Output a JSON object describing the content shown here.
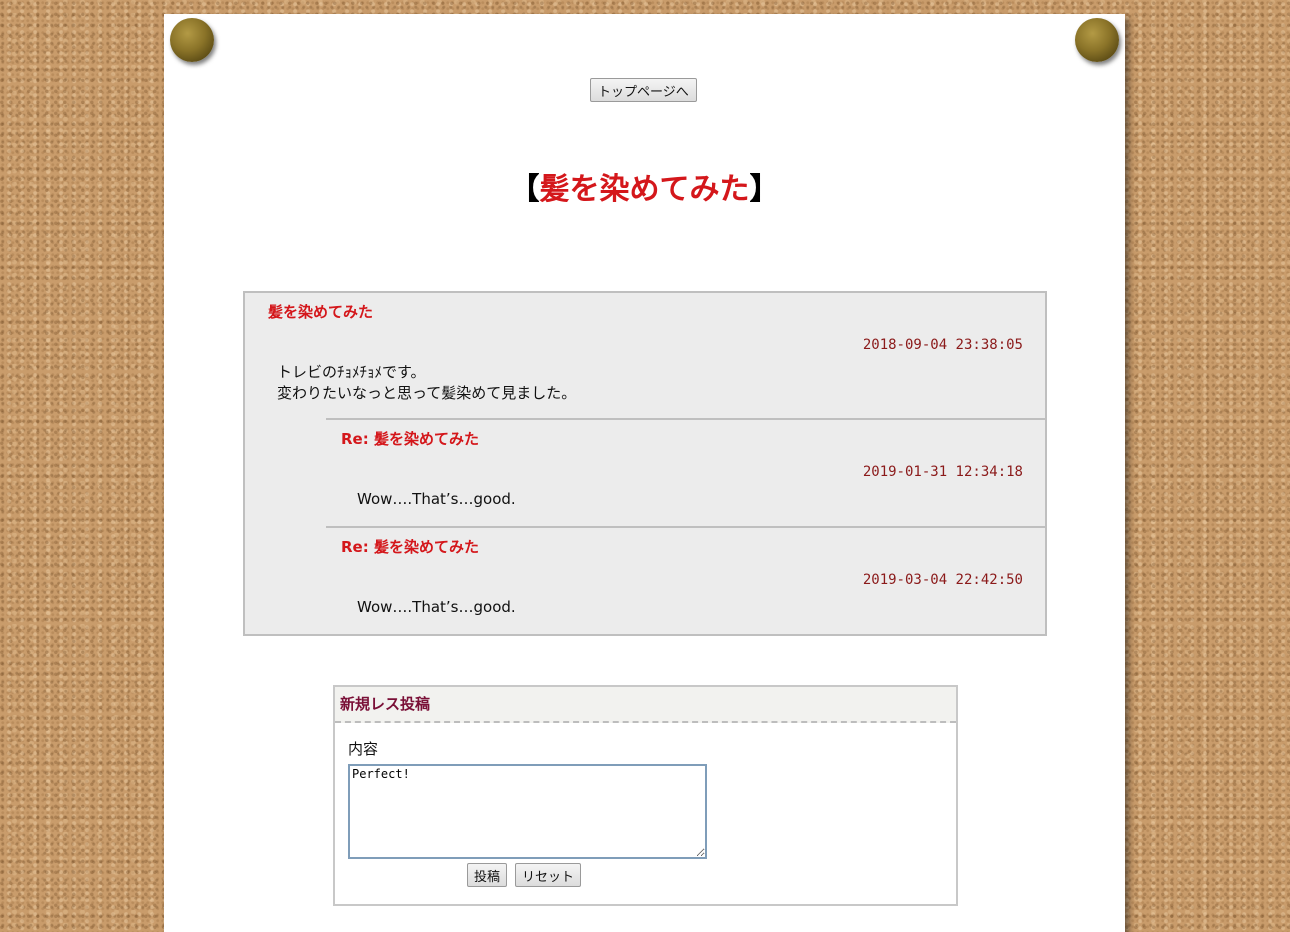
{
  "nav": {
    "top_button": "トップページへ"
  },
  "page": {
    "title_open": "【",
    "title_text": "髪を染めてみた",
    "title_close": "】"
  },
  "thread": {
    "post": {
      "title": "髪を染めてみた",
      "date": "2018-09-04 23:38:05",
      "body": "トレビのﾁｮﾒﾁｮﾒです。\n変わりたいなっと思って髪染めて見ました。"
    },
    "replies": [
      {
        "title": "Re: 髪を染めてみた",
        "date": "2019-01-31 12:34:18",
        "body": "Wow….That’s…good."
      },
      {
        "title": "Re: 髪を染めてみた",
        "date": "2019-03-04 22:42:50",
        "body": "Wow….That’s…good."
      }
    ]
  },
  "reply_form": {
    "heading": "新規レス投稿",
    "content_label": "内容",
    "content_value": "Perfect!",
    "submit_label": "投稿",
    "reset_label": "リセット"
  },
  "colors": {
    "accent_red": "#d4171b",
    "date_color": "#8b1a1a",
    "form_heading": "#7a1037"
  }
}
